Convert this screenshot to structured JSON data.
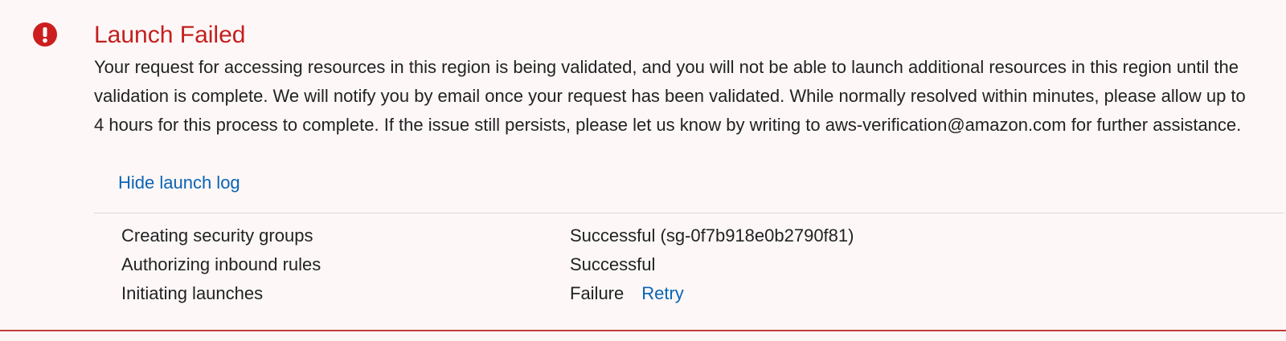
{
  "alert": {
    "icon": "exclamation-circle-icon",
    "title": "Launch Failed",
    "message": "Your request for accessing resources in this region is being validated, and you will not be able to launch additional resources in this region until the validation is complete. We will notify you by email once your request has been validated. While normally resolved within minutes, please allow up to 4 hours for this process to complete. If the issue still persists, please let us know by writing to aws-verification@amazon.com for further assistance.",
    "toggle_link": "Hide launch log",
    "colors": {
      "error": "#c41f1f",
      "link": "#0a64b3",
      "background": "#fdf7f7"
    }
  },
  "launch_log": {
    "rows": [
      {
        "step": "Creating security groups",
        "status": "Successful (sg-0f7b918e0b2790f81)"
      },
      {
        "step": "Authorizing inbound rules",
        "status": "Successful"
      },
      {
        "step": "Initiating launches",
        "status": "Failure",
        "action": "Retry"
      }
    ]
  }
}
